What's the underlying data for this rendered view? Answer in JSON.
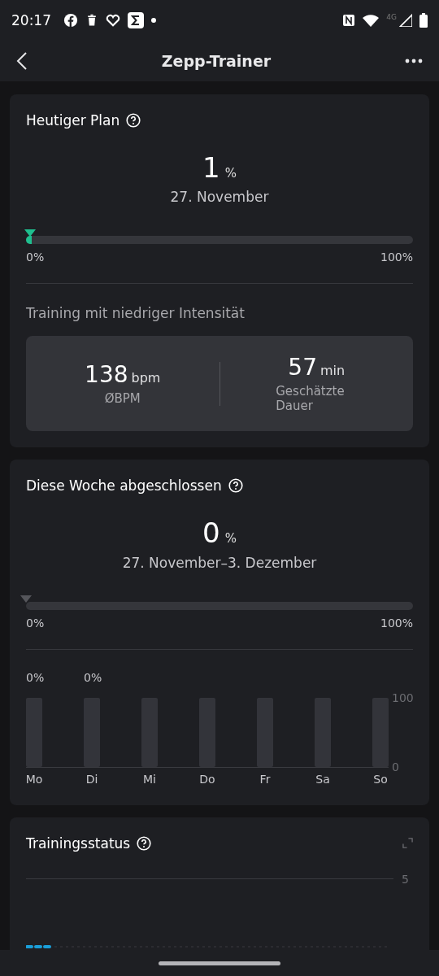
{
  "status_bar": {
    "time": "20:17",
    "network": "4G"
  },
  "header": {
    "title": "Zepp-Trainer"
  },
  "today_plan": {
    "title": "Heutiger Plan",
    "value": "1",
    "unit": "%",
    "date": "27. November",
    "progress": {
      "level": 0.01,
      "min_label": "0%",
      "max_label": "100%"
    },
    "training_title": "Training mit niedriger Intensität",
    "stats": [
      {
        "value": "138",
        "unit": "bpm",
        "label": "ØBPM"
      },
      {
        "value": "57",
        "unit": "min",
        "label": "Geschätzte Dauer"
      }
    ]
  },
  "week": {
    "title": "Diese Woche abgeschlossen",
    "value": "0",
    "unit": "%",
    "date": "27. November–3. Dezember",
    "progress": {
      "level": 0,
      "min_label": "0%",
      "max_label": "100%"
    },
    "chart_data": {
      "type": "bar",
      "categories": [
        "Mo",
        "Di",
        "Mi",
        "Do",
        "Fr",
        "Sa",
        "So"
      ],
      "series": [
        {
          "values": [
            0,
            0,
            null,
            null,
            null,
            null,
            null
          ]
        },
        {
          "color": "#33343a",
          "values": [
            100,
            100,
            100,
            100,
            100,
            100,
            100
          ]
        }
      ],
      "value_labels": [
        "0%",
        "0%",
        null,
        null,
        null,
        null,
        null
      ],
      "ylim": [
        0,
        100
      ],
      "yticks": [
        0,
        100
      ]
    }
  },
  "training_status": {
    "title": "Trainingsstatus",
    "y_tick": "5"
  }
}
